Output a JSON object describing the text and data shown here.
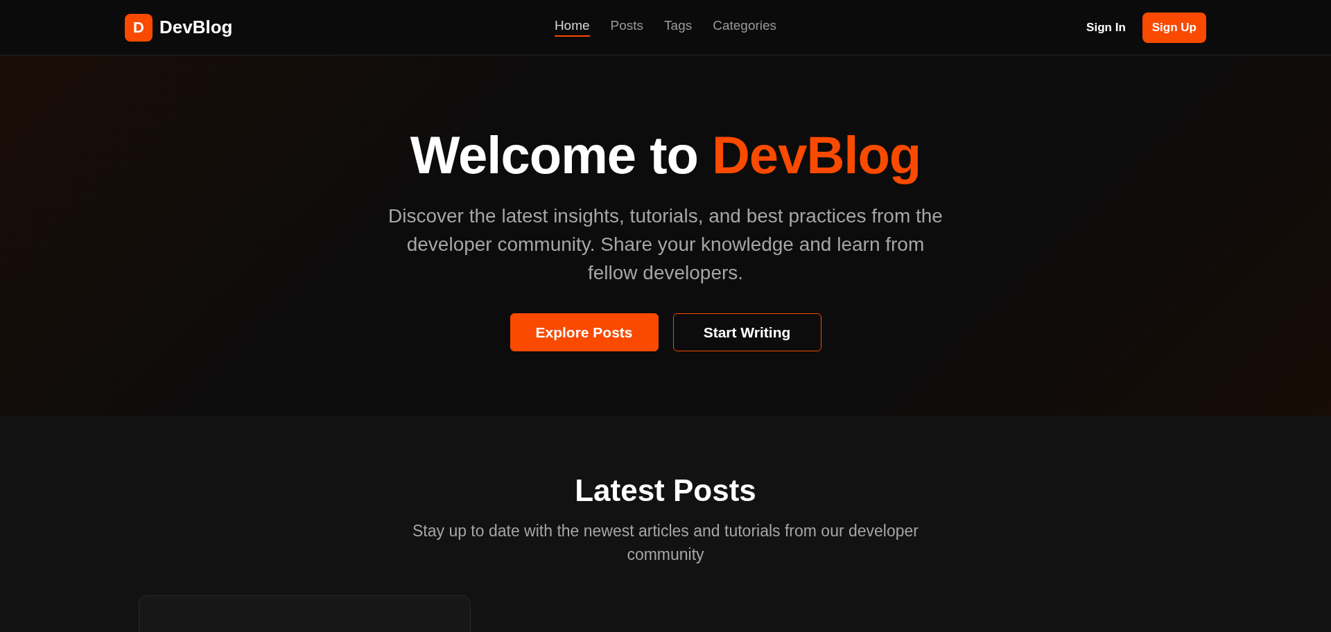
{
  "nav": {
    "logo_letter": "D",
    "brand": "DevBlog",
    "links": [
      {
        "label": "Home",
        "selected": true
      },
      {
        "label": "Posts",
        "selected": false
      },
      {
        "label": "Tags",
        "selected": false
      },
      {
        "label": "Categories",
        "selected": false
      }
    ],
    "sign_in": "Sign In",
    "sign_up": "Sign Up"
  },
  "hero": {
    "title": "Welcome to",
    "title_highlight": "DevBlog",
    "subtitle": "Discover the latest insights, tutorials, and best practices from the developer community. Share your knowledge and learn from fellow developers.",
    "buttons": [
      {
        "label": "Explore Posts",
        "kind": "primary"
      },
      {
        "label": "Start Writing",
        "kind": "outline"
      }
    ]
  },
  "latest": {
    "heading": "Latest Posts",
    "subtitle": "Stay up to date with the newest articles and tutorials from our developer community",
    "cards": [
      {
        "kind": "card"
      }
    ]
  }
}
